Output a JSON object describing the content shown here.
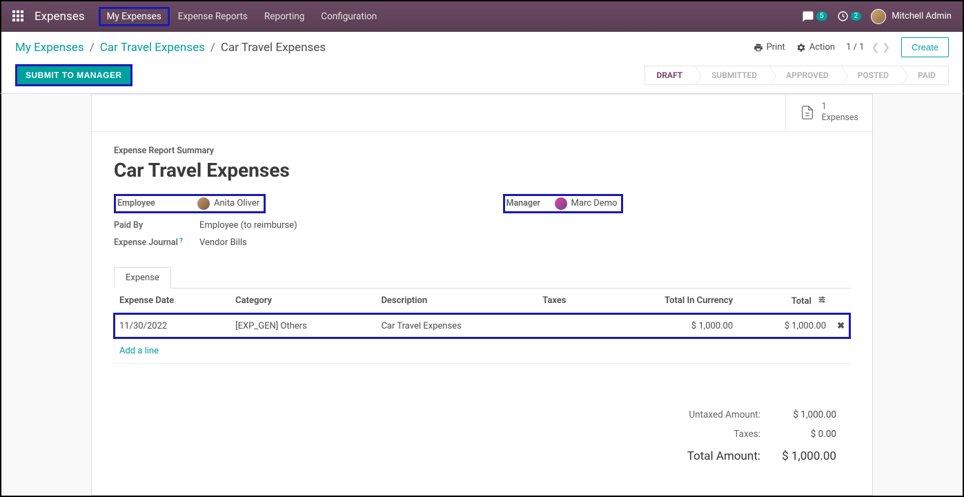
{
  "navbar": {
    "brand": "Expenses",
    "items": [
      {
        "label": "My Expenses",
        "active": true
      },
      {
        "label": "Expense Reports",
        "active": false
      },
      {
        "label": "Reporting",
        "active": false
      },
      {
        "label": "Configuration",
        "active": false
      }
    ],
    "chat_count": "5",
    "activity_count": "2",
    "user": "Mitchell Admin"
  },
  "breadcrumb": {
    "items": [
      {
        "label": "My Expenses",
        "link": true
      },
      {
        "label": "Car Travel Expenses",
        "link": true
      },
      {
        "label": "Car Travel Expenses",
        "link": false
      }
    ]
  },
  "actions": {
    "print": "Print",
    "action": "Action",
    "pager": "1 / 1",
    "create": "Create"
  },
  "status": {
    "submit_label": "SUBMIT TO MANAGER",
    "steps": [
      {
        "label": "DRAFT",
        "active": true
      },
      {
        "label": "SUBMITTED",
        "active": false
      },
      {
        "label": "APPROVED",
        "active": false
      },
      {
        "label": "POSTED",
        "active": false
      },
      {
        "label": "PAID",
        "active": false
      }
    ]
  },
  "stat_button": {
    "count": "1",
    "label": "Expenses"
  },
  "form": {
    "summary_label": "Expense Report Summary",
    "title": "Car Travel Expenses",
    "employee_label": "Employee",
    "employee_value": "Anita Oliver",
    "manager_label": "Manager",
    "manager_value": "Marc Demo",
    "paidby_label": "Paid By",
    "paidby_value": "Employee (to reimburse)",
    "journal_label": "Expense Journal",
    "journal_value": "Vendor Bills"
  },
  "tab": {
    "expense": "Expense"
  },
  "table": {
    "headers": {
      "date": "Expense Date",
      "category": "Category",
      "description": "Description",
      "taxes": "Taxes",
      "total_currency": "Total In Currency",
      "total": "Total"
    },
    "rows": [
      {
        "date": "11/30/2022",
        "category": "[EXP_GEN] Others",
        "description": "Car Travel Expenses",
        "taxes": "",
        "total_currency": "$ 1,000.00",
        "total": "$ 1,000.00"
      }
    ],
    "add_line": "Add a line"
  },
  "totals": {
    "untaxed_label": "Untaxed Amount:",
    "untaxed_value": "$ 1,000.00",
    "taxes_label": "Taxes:",
    "taxes_value": "$ 0.00",
    "total_label": "Total Amount:",
    "total_value": "$ 1,000.00"
  }
}
